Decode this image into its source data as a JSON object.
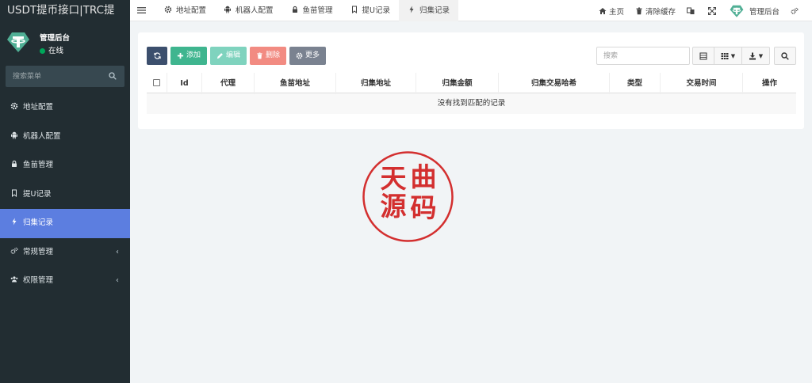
{
  "app": {
    "brand": "USDT提币接口|TRC提",
    "user_name": "管理后台",
    "user_status": "在线"
  },
  "sidebar": {
    "search_placeholder": "搜索菜单",
    "items": [
      {
        "label": "地址配置",
        "icon": "gear-icon"
      },
      {
        "label": "机器人配置",
        "icon": "android-icon"
      },
      {
        "label": "鱼苗管理",
        "icon": "lock-icon"
      },
      {
        "label": "提U记录",
        "icon": "bookmark-icon"
      },
      {
        "label": "归集记录",
        "icon": "bolt-icon",
        "active": true
      },
      {
        "label": "常规管理",
        "icon": "cogs-icon",
        "has_children": true
      },
      {
        "label": "权限管理",
        "icon": "users-icon",
        "has_children": true
      }
    ]
  },
  "topbar": {
    "tabs": [
      {
        "label": "地址配置",
        "icon": "gear-icon"
      },
      {
        "label": "机器人配置",
        "icon": "android-icon"
      },
      {
        "label": "鱼苗管理",
        "icon": "lock-icon"
      },
      {
        "label": "提U记录",
        "icon": "bookmark-icon"
      },
      {
        "label": "归集记录",
        "icon": "bolt-icon",
        "active": true
      }
    ],
    "home_label": "主页",
    "clear_cache_label": "清除缓存",
    "admin_label": "管理后台"
  },
  "toolbar": {
    "add_label": "添加",
    "edit_label": "编辑",
    "delete_label": "删除",
    "more_label": "更多",
    "search_placeholder": "搜索"
  },
  "table": {
    "columns": [
      "Id",
      "代理",
      "鱼苗地址",
      "归集地址",
      "归集金额",
      "归集交易哈希",
      "类型",
      "交易时间",
      "操作"
    ],
    "empty_text": "没有找到匹配的记录"
  },
  "seal": {
    "chars": [
      "天",
      "曲",
      "源",
      "码"
    ]
  },
  "colors": {
    "sidebar_bg": "#222d32",
    "active_item": "#5c7ee0",
    "add_button": "#3fb58f",
    "edit_button": "#7fd3be",
    "delete_button": "#f28b82",
    "more_button": "#7a8290",
    "seal_red": "#d32f2f"
  }
}
